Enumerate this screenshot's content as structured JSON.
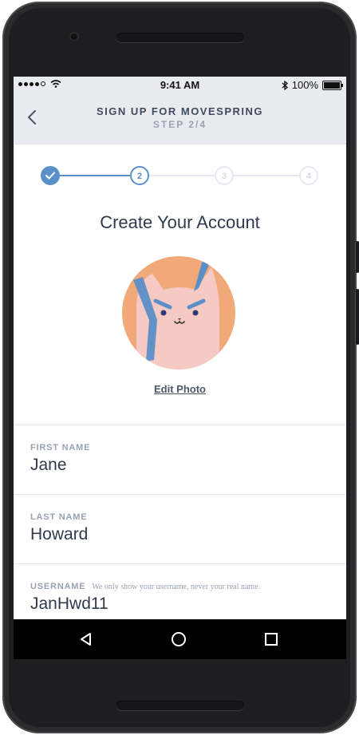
{
  "status_bar": {
    "time": "9:41 AM",
    "battery": "100%",
    "signal_icon": "signal-dots-icon",
    "wifi_icon": "wifi-icon",
    "bluetooth_icon": "bluetooth-icon"
  },
  "header": {
    "title": "SIGN UP FOR MOVESPRING",
    "subtitle": "STEP 2/4",
    "back_icon": "chevron-left-icon"
  },
  "stepper": {
    "steps": [
      {
        "label": "✓",
        "state": "complete"
      },
      {
        "label": "2",
        "state": "current"
      },
      {
        "label": "3",
        "state": "upcoming"
      },
      {
        "label": "4",
        "state": "upcoming"
      }
    ],
    "active_color": "#5b8fc9",
    "inactive_color": "#e6e9ef"
  },
  "main": {
    "title": "Create Your Account",
    "avatar_icon": "cat-avatar-icon",
    "edit_photo_label": "Edit Photo"
  },
  "fields": [
    {
      "label": "FIRST NAME",
      "hint": "",
      "value": "Jane"
    },
    {
      "label": "LAST NAME",
      "hint": "",
      "value": "Howard"
    },
    {
      "label": "USERNAME",
      "hint": "We only show your username, never your real name.",
      "value": "JanHwd11"
    }
  ],
  "nav": {
    "back_icon": "triangle-back-icon",
    "home_icon": "circle-home-icon",
    "recents_icon": "square-recents-icon"
  },
  "colors": {
    "header_bg": "#e9ebf1",
    "avatar_bg": "#f2a97a",
    "avatar_face": "#f5c9c4",
    "accent_blue": "#5b8fc9"
  }
}
